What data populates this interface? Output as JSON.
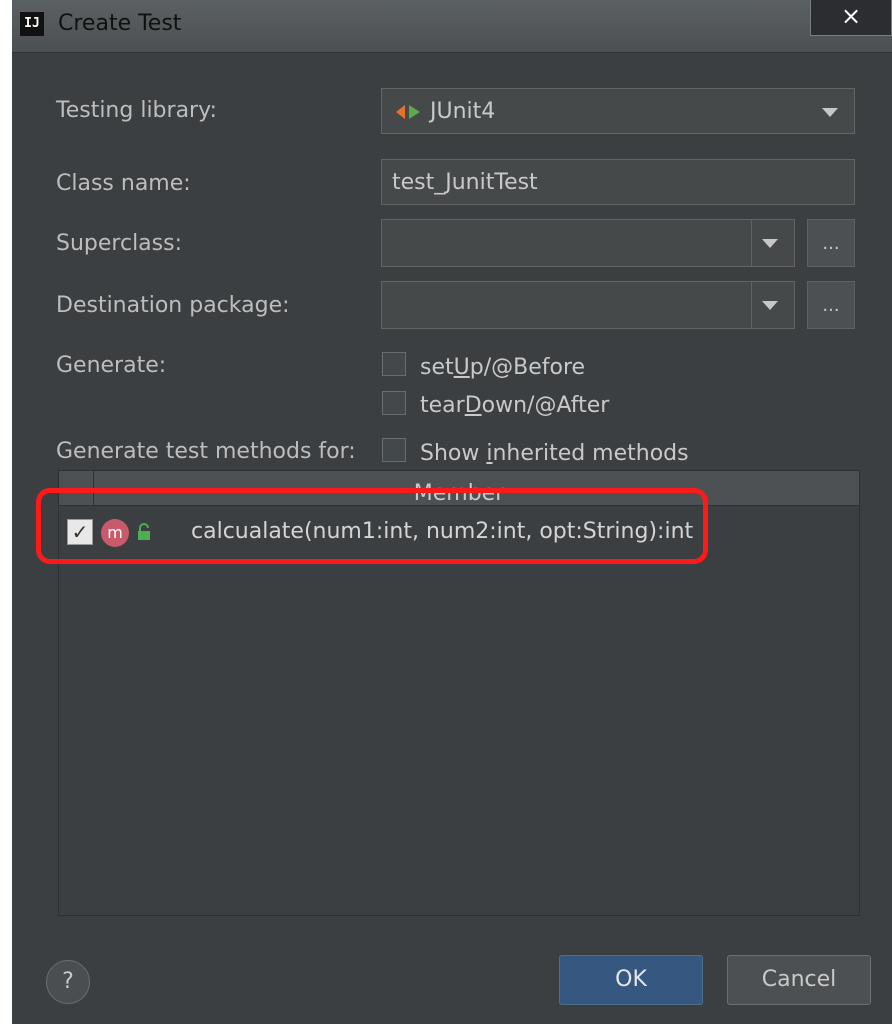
{
  "window": {
    "title": "Create Test",
    "logo_text": "IJ",
    "close_glyph": "×"
  },
  "form": {
    "testing_library_label": "Testing library:",
    "testing_library_value": "JUnit4",
    "class_name_label": "Class name:",
    "class_name_value": "test_JunitTest",
    "superclass_label": "Superclass:",
    "superclass_value": "",
    "destination_package_label": "Destination package:",
    "destination_package_value": "",
    "browse_label": "...",
    "generate_label": "Generate:",
    "setup_pre": "set",
    "setup_u": "U",
    "setup_post": "p/@Before",
    "setup_checked": false,
    "teardown_pre": "tear",
    "teardown_u": "D",
    "teardown_post": "own/@After",
    "teardown_checked": false,
    "methods_for_label": "Generate test methods for:",
    "show_inherited_pre": "Show ",
    "show_inherited_u": "i",
    "show_inherited_post": "nherited methods",
    "show_inherited_checked": false
  },
  "table": {
    "column_header": "Member",
    "rows": [
      {
        "checked": true,
        "checkmark": "✓",
        "method_icon_letter": "m",
        "signature": "calcualate(num1:int, num2:int, opt:String):int"
      }
    ]
  },
  "footer": {
    "help_label": "?",
    "ok_label": "OK",
    "cancel_label": "Cancel"
  },
  "icons": {
    "app_logo": "intellij-logo-icon",
    "junit": "junit-icon",
    "method": "method-icon",
    "lock": "lock-open-icon",
    "dropdown": "chevron-down-icon",
    "help": "help-icon"
  },
  "colors": {
    "background": "#3c3f41",
    "ok_button": "#365880",
    "highlight": "#ff1a1a",
    "method_icon": "#c75b6b",
    "lock_icon": "#4caf50"
  }
}
